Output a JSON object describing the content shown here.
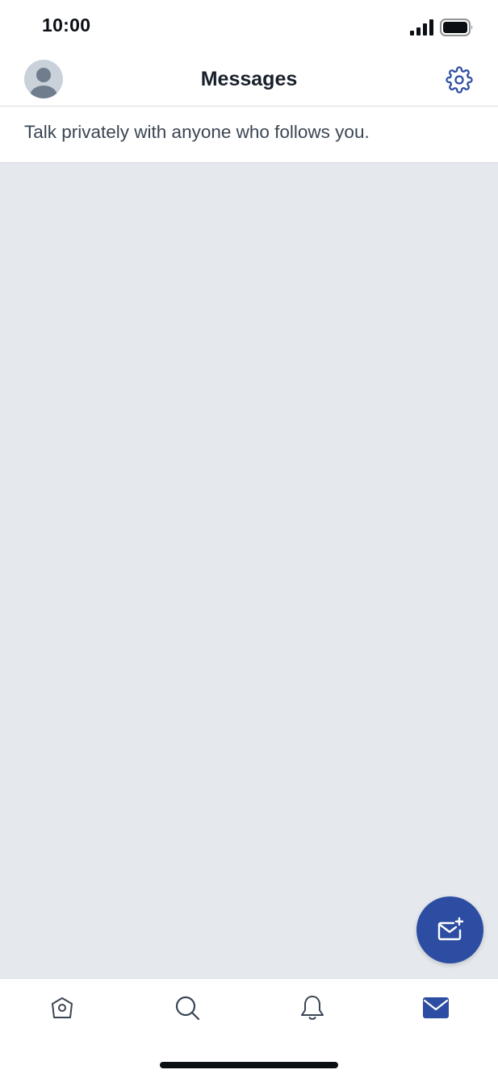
{
  "status_bar": {
    "time": "10:00",
    "signal_icon": "cellular-signal-icon",
    "battery_icon": "battery-icon"
  },
  "header": {
    "title": "Messages",
    "avatar_icon": "default-avatar-icon",
    "settings_icon": "gear-icon"
  },
  "subtitle": "Talk privately with anyone who follows you.",
  "fab": {
    "icon": "compose-message-icon"
  },
  "tabs": [
    {
      "name": "home",
      "icon": "home-icon",
      "active": false
    },
    {
      "name": "search",
      "icon": "search-icon",
      "active": false
    },
    {
      "name": "notifications",
      "icon": "bell-icon",
      "active": false
    },
    {
      "name": "messages",
      "icon": "envelope-icon",
      "active": true
    }
  ],
  "colors": {
    "accent": "#2c4da1",
    "content_background": "#e5e9ee",
    "divider": "#d7dde4",
    "icon": "#3a4553"
  }
}
